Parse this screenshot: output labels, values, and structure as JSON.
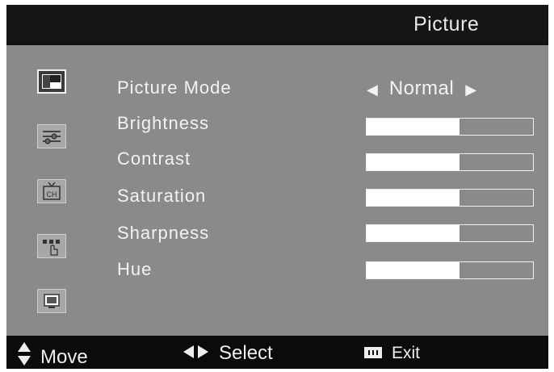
{
  "header": {
    "title": "Picture"
  },
  "sidebar": {
    "icons": [
      {
        "name": "picture-icon",
        "active": true
      },
      {
        "name": "sound-equalizer-icon",
        "active": false
      },
      {
        "name": "channel-icon",
        "label": "CH",
        "active": false
      },
      {
        "name": "features-icon",
        "active": false
      },
      {
        "name": "screen-icon",
        "active": false
      }
    ]
  },
  "menu": {
    "picture_mode": {
      "label": "Picture  Mode",
      "value": "Normal",
      "left_arrow": "◀",
      "right_arrow": "▶"
    },
    "items": [
      {
        "label": "Brightness",
        "level": 0.56
      },
      {
        "label": "Contrast",
        "level": 0.56
      },
      {
        "label": "Saturation",
        "level": 0.56
      },
      {
        "label": "Sharpness",
        "level": 0.56
      },
      {
        "label": "Hue",
        "level": 0.56
      }
    ]
  },
  "footer": {
    "move": {
      "glyph": "updown-arrow-icon",
      "label": "Move"
    },
    "select": {
      "glyph": "leftright-arrow-icon",
      "label": "Select"
    },
    "exit": {
      "glyph": "menu-button-icon",
      "label": "Exit"
    }
  },
  "colors": {
    "panel": "#8a8a8a",
    "header": "#151515",
    "footer": "#0b0b0b",
    "text": "#f2f2f2",
    "bar_fill": "#ffffff"
  }
}
